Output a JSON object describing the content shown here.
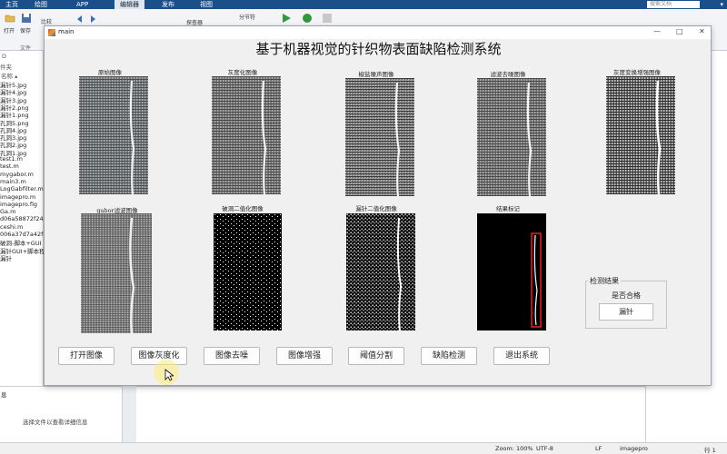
{
  "matlab": {
    "tabs": [
      "主页",
      "绘图",
      "APP",
      "编辑器",
      "发布",
      "视图"
    ],
    "active_tab": "编辑器",
    "search_placeholder": "搜索文档",
    "ribbon_labels": {
      "open": "打开",
      "save": "保存",
      "compare": "比较",
      "file_group": "文件",
      "section_break": "分节符",
      "browser": "探查器"
    },
    "path_prefix": "D",
    "file_panel_header": "件夹",
    "name_column": "名称 ▴",
    "files": [
      "漏针5.jpg",
      "漏针4.jpg",
      "漏针3.jpg",
      "漏针2.png",
      "漏针1.png",
      "孔洞5.png",
      "孔洞4.jpg",
      "孔洞3.jpg",
      "孔洞2.jpg",
      "孔洞1.jpg",
      "test1.m",
      "test.m",
      "mygabor.m",
      "main3.m",
      "LogGabfilter.m",
      "imagepro.m",
      "imagepro.fig",
      "Ga.m",
      "d06a58872f243...",
      "ceshi.m",
      "006a37d7a42f6...",
      "破洞-脚本+GUI",
      "漏针GUI+脚本程序",
      "漏针"
    ],
    "details_header": "息",
    "details_text": "选择文件以查看详细信息",
    "status": {
      "zoom": "Zoom: 100%",
      "encoding": "UTF-8",
      "eol": "LF",
      "script": "imagepro",
      "line": "行 1"
    }
  },
  "window": {
    "title": "main",
    "heading": "基于机器视觉的针织物表面缺陷检测系统",
    "controls": [
      "—",
      "□",
      "✕"
    ]
  },
  "images": [
    {
      "caption": "原始图像",
      "kind": "fabric"
    },
    {
      "caption": "灰度化图像",
      "kind": "fabric"
    },
    {
      "caption": "椒盐噪声图像",
      "kind": "fabric"
    },
    {
      "caption": "滤波去噪图像",
      "kind": "fabric"
    },
    {
      "caption": "灰度变换增强图像",
      "kind": "fabric"
    },
    {
      "caption": "gabor滤波图像",
      "kind": "fabric"
    },
    {
      "caption": "破洞二值化图像",
      "kind": "binary-dots"
    },
    {
      "caption": "漏针二值化图像",
      "kind": "binary-dense"
    },
    {
      "caption": "结果标记",
      "kind": "result"
    }
  ],
  "buttons": [
    "打开图像",
    "图像灰度化",
    "图像去噪",
    "图像增强",
    "阈值分割",
    "缺陷检测",
    "退出系统"
  ],
  "result": {
    "group_title": "检测结果",
    "label": "是否合格",
    "value": "漏针"
  },
  "colors": {
    "titlebar_blue": "#1a4f8a",
    "marker_red": "#ff2020",
    "highlight_yellow": "#ffec78"
  }
}
